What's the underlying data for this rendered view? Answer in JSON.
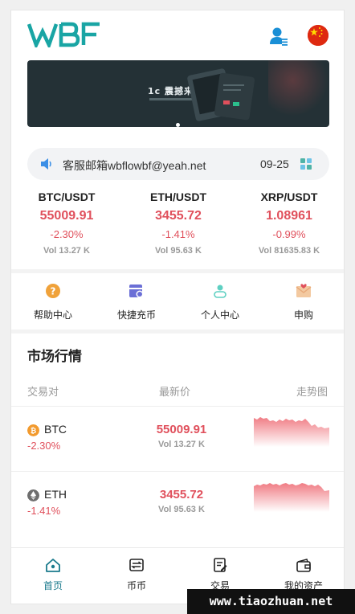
{
  "header": {
    "logo_text": "WBF"
  },
  "notice": {
    "text": "客服邮箱wbflowbf@yeah.net",
    "date": "09-25"
  },
  "banner": {
    "text": "1c 震撼来袭"
  },
  "tickers": [
    {
      "pair": "BTC/USDT",
      "price": "55009.91",
      "change": "-2.30%",
      "volume": "Vol 13.27 K"
    },
    {
      "pair": "ETH/USDT",
      "price": "3455.72",
      "change": "-1.41%",
      "volume": "Vol 95.63 K"
    },
    {
      "pair": "XRP/USDT",
      "price": "1.08961",
      "change": "-0.99%",
      "volume": "Vol 81635.83 K"
    }
  ],
  "menu": [
    {
      "label": "帮助中心",
      "icon": "help-icon"
    },
    {
      "label": "快捷充币",
      "icon": "deposit-icon"
    },
    {
      "label": "个人中心",
      "icon": "profile-icon"
    },
    {
      "label": "申购",
      "icon": "subscribe-icon"
    }
  ],
  "market": {
    "title": "市场行情",
    "columns": [
      "交易对",
      "最新价",
      "走势图"
    ],
    "rows": [
      {
        "coin": "BTC",
        "change": "-2.30%",
        "price": "55009.91",
        "volume": "Vol 13.27 K",
        "icon": "bitcoin-icon"
      },
      {
        "coin": "ETH",
        "change": "-1.41%",
        "price": "3455.72",
        "volume": "Vol 95.63 K",
        "icon": "ethereum-icon"
      }
    ]
  },
  "tabbar": [
    {
      "label": "首页",
      "icon": "home-icon",
      "active": true
    },
    {
      "label": "币币",
      "icon": "coin-exchange-icon",
      "active": false
    },
    {
      "label": "交易",
      "icon": "trade-icon",
      "active": false
    },
    {
      "label": "我的资产",
      "icon": "wallet-icon",
      "active": false
    }
  ],
  "watermark": {
    "text": "www.tiaozhuan.net"
  },
  "colors": {
    "accent": "#1a9aa8",
    "down": "#e0505c",
    "muted": "#999999"
  }
}
